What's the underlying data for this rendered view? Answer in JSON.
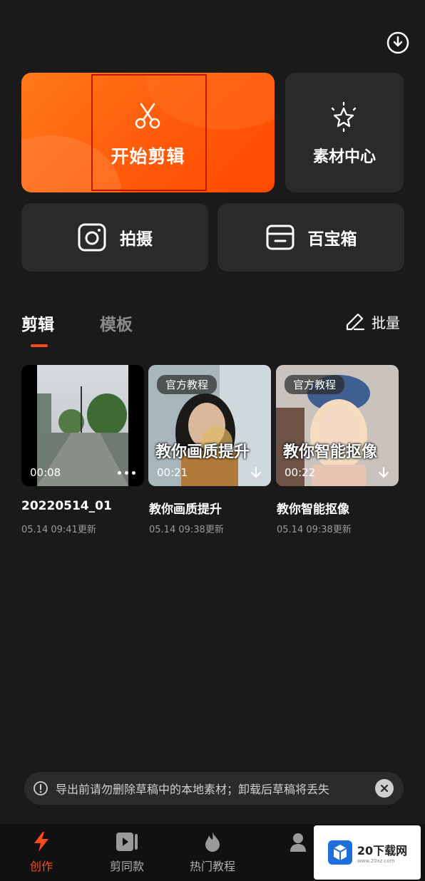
{
  "top": {
    "history_icon": "history-download-icon"
  },
  "quick_actions": {
    "start_edit": "开始剪辑",
    "materials": "素材中心",
    "shoot": "拍摄",
    "toolbox": "百宝箱"
  },
  "tabs": {
    "edit": "剪辑",
    "template": "模板",
    "batch": "批量"
  },
  "projects": [
    {
      "title": "20220514_01",
      "updated": "05.14 09:41更新",
      "duration": "00:08"
    },
    {
      "title": "教你画质提升",
      "updated": "05.14 09:38更新",
      "duration": "00:21",
      "tag": "官方教程",
      "caption": "教你画质提升"
    },
    {
      "title": "教你智能抠像",
      "updated": "05.14 09:38更新",
      "duration": "00:22",
      "tag": "官方教程",
      "caption": "教你智能抠像"
    }
  ],
  "notice": {
    "text": "导出前请勿删除草稿中的本地素材；卸载后草稿将丢失"
  },
  "bottom_nav": [
    {
      "label": "创作",
      "icon": "lightning-icon",
      "active": true
    },
    {
      "label": "剪同款",
      "icon": "play-template-icon",
      "active": false
    },
    {
      "label": "热门教程",
      "icon": "flame-icon",
      "active": false
    }
  ],
  "watermark": {
    "text": "20下载网",
    "sub": "www.20xz.com"
  },
  "colors": {
    "accent": "#ff4a1a",
    "orange": "#ff6a12",
    "background": "#1a1a1a",
    "card": "#2a2a2b"
  }
}
